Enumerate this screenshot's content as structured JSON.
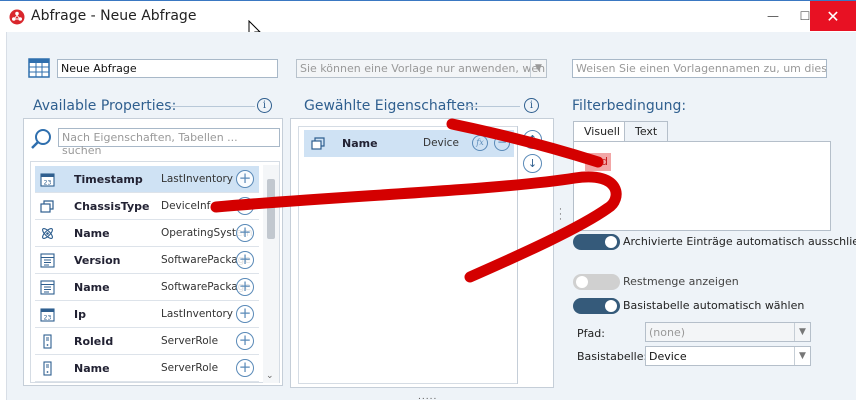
{
  "window": {
    "title": "Abfrage - Neue Abfrage",
    "minimize": "—",
    "maximize": "☐",
    "close": "✕"
  },
  "header": {
    "query_name": "Neue Abfrage",
    "template_placeholder": "Sie können eine Vorlage nur anwenden, wenn...",
    "template_name_placeholder": "Weisen Sie einen Vorlagennamen zu, um diese Abfra"
  },
  "available": {
    "title": "Available Properties:",
    "search_placeholder": "Nach Eigenschaften, Tabellen ... suchen",
    "items": [
      {
        "name": "Timestamp",
        "source": "LastInventory",
        "icon": "calendar-icon",
        "selected": true
      },
      {
        "name": "ChassisType",
        "source": "DeviceInfo",
        "icon": "windows-icon",
        "selected": false
      },
      {
        "name": "Name",
        "source": "OperatingSystem",
        "icon": "atom-icon",
        "selected": false
      },
      {
        "name": "Version",
        "source": "SoftwarePackage",
        "icon": "package-icon",
        "selected": false
      },
      {
        "name": "Name",
        "source": "SoftwarePackage",
        "icon": "package-icon",
        "selected": false
      },
      {
        "name": "Ip",
        "source": "LastInventory",
        "icon": "calendar-icon",
        "selected": false
      },
      {
        "name": "RoleId",
        "source": "ServerRole",
        "icon": "server-icon",
        "selected": false
      },
      {
        "name": "Name",
        "source": "ServerRole",
        "icon": "server-icon",
        "selected": false
      }
    ]
  },
  "selected": {
    "title": "Gewählte Eigenschaften:",
    "items": [
      {
        "name": "Name",
        "source": "Device",
        "icon": "windows-icon"
      }
    ]
  },
  "filter": {
    "title": "Filterbedingung:",
    "tabs": [
      {
        "label": "Visuell",
        "active": true
      },
      {
        "label": "Text",
        "active": false
      }
    ],
    "operator": "und"
  },
  "options": {
    "archived_label": "Archivierte Einträge automatisch ausschlie",
    "archived_on": true,
    "remainder_label": "Restmenge anzeigen",
    "remainder_on": false,
    "basetable_auto_label": "Basistabelle automatisch wählen",
    "basetable_auto_on": true,
    "path_label": "Pfad:",
    "path_value": "(none)",
    "basetable_label": "Basistabelle:",
    "basetable_value": "Device"
  },
  "colors": {
    "accent": "#2f5f8f",
    "selection": "#cfe2f4",
    "annotation_arrow": "#d40000",
    "operator_chip": "#f2a6a6"
  }
}
